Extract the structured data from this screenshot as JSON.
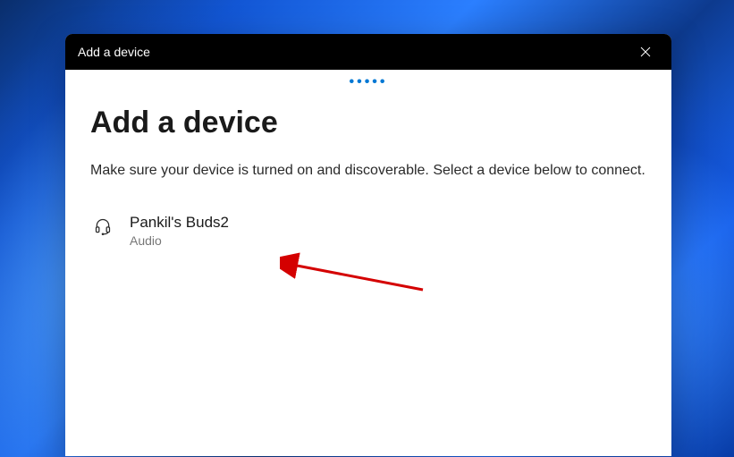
{
  "titlebar": {
    "text": "Add a device"
  },
  "content": {
    "heading": "Add a device",
    "subtext": "Make sure your device is turned on and discoverable. Select a device below to connect."
  },
  "devices": [
    {
      "name": "Pankil's Buds2",
      "type": "Audio",
      "iconType": "headset-icon"
    }
  ],
  "loadingIndicator": "•••••"
}
